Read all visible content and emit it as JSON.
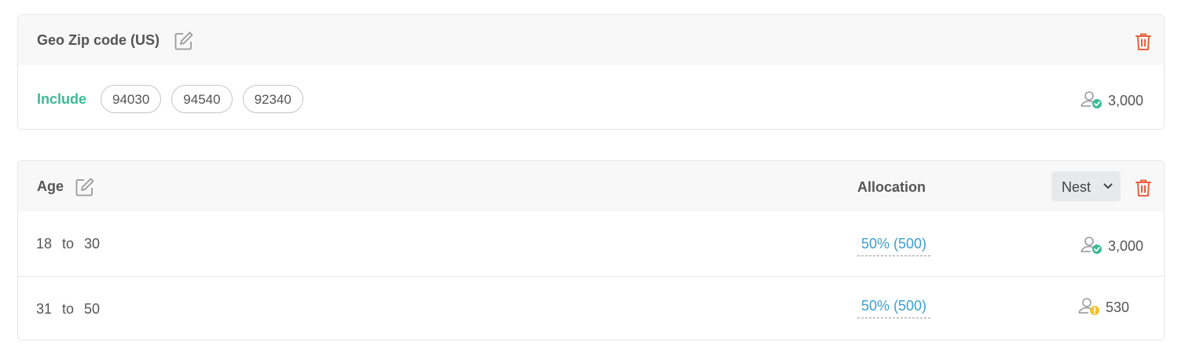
{
  "geo_card": {
    "title": "Geo Zip code (US)",
    "mode_label": "Include",
    "zip_codes": [
      "94030",
      "94540",
      "92340"
    ],
    "reach": {
      "value": "3,000",
      "status": "ok",
      "icon": "user-check-icon"
    }
  },
  "age_card": {
    "title": "Age",
    "allocation_header": "Allocation",
    "nest_label": "Nest",
    "rows": [
      {
        "from": "18",
        "to_word": "to",
        "to": "30",
        "allocation": "50% (500)",
        "reach": "3,000",
        "status": "ok"
      },
      {
        "from": "31",
        "to_word": "to",
        "to": "50",
        "allocation": "50% (500)",
        "reach": "530",
        "status": "warning"
      }
    ]
  },
  "colors": {
    "include_green": "#3dbb95",
    "link_blue": "#3c9fd0",
    "delete_red": "#e8603c",
    "ok_green": "#3dbb95",
    "warning_yellow": "#f3c232"
  }
}
